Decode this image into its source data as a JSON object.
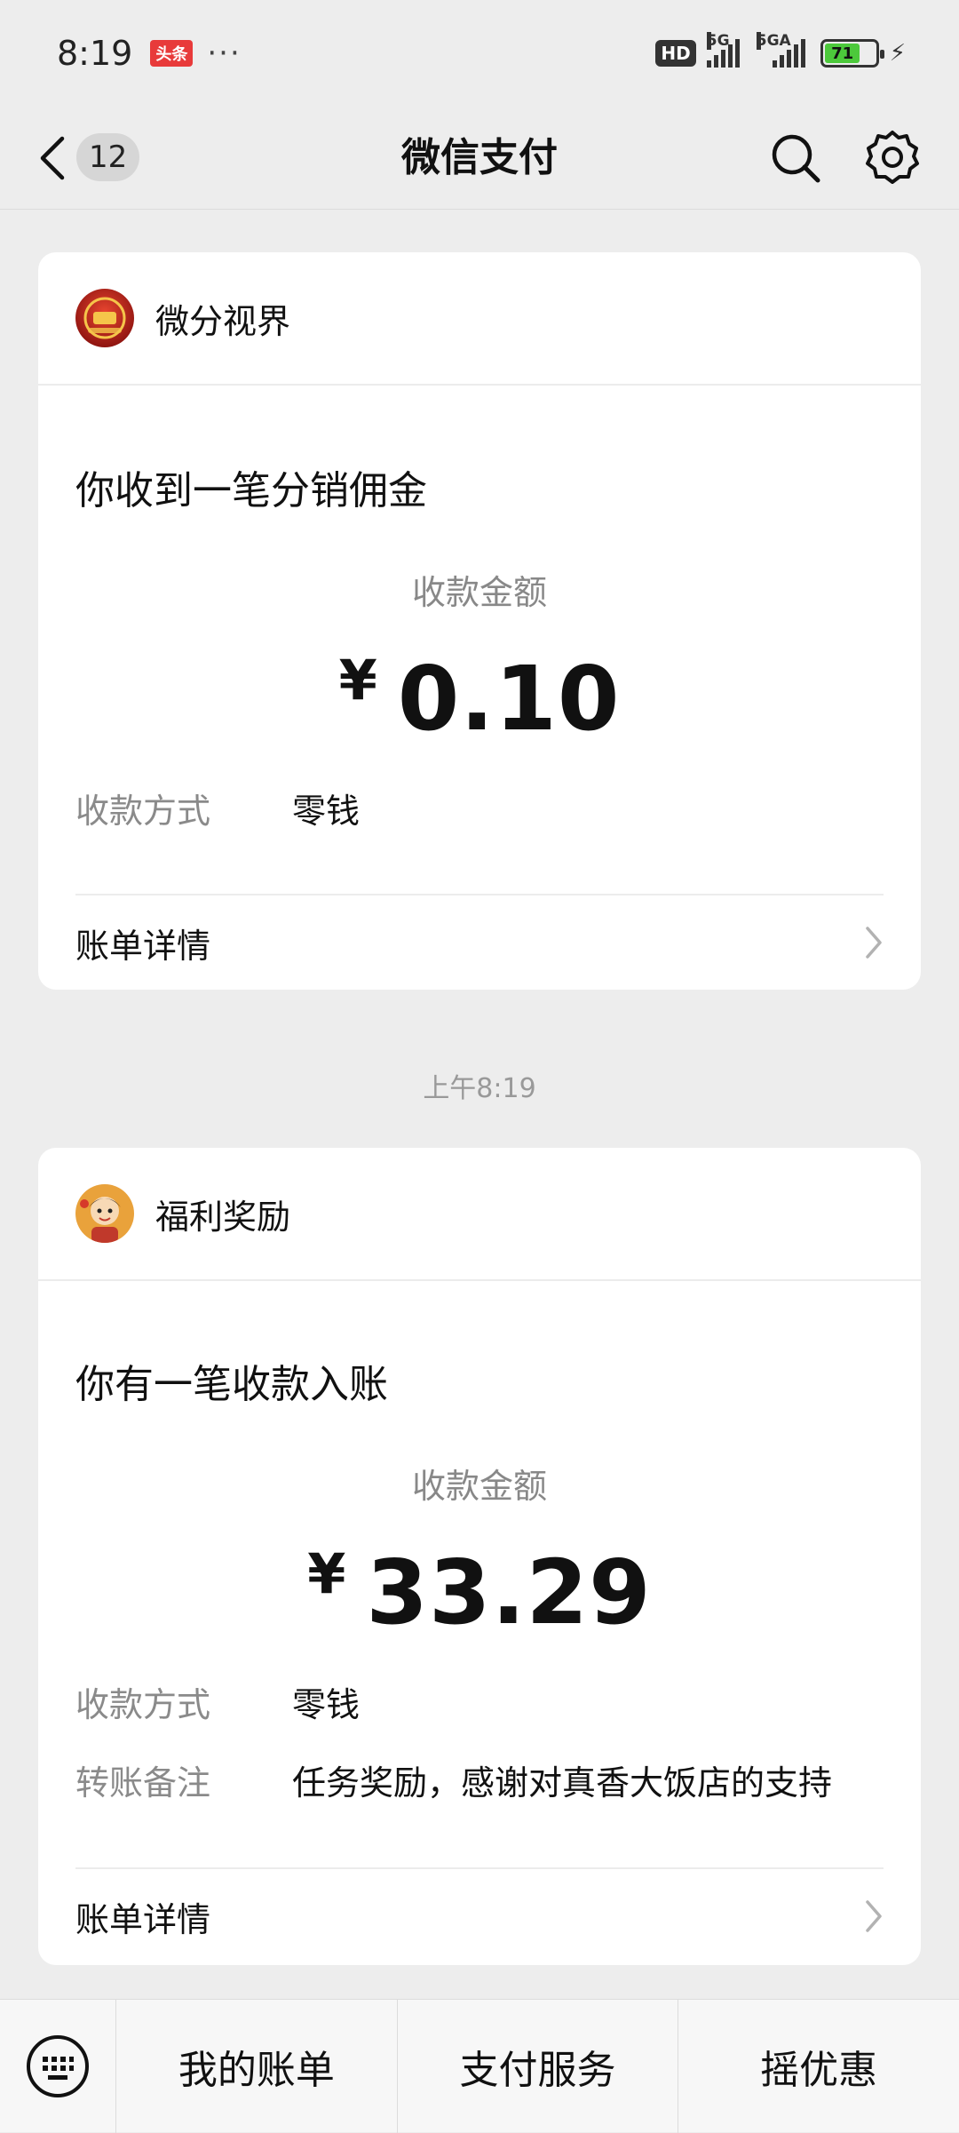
{
  "status_bar": {
    "time": "8:19",
    "app_badge": "头条",
    "dots": "···",
    "hd": "HD",
    "signal1_label": "5G",
    "signal2_label": "5GA",
    "battery": "71"
  },
  "nav": {
    "unread_count": "12",
    "title": "微信支付"
  },
  "messages": [
    {
      "merchant": "微分视界",
      "title": "你收到一笔分销佣金",
      "amount_label": "收款金额",
      "currency": "¥",
      "amount": "0.10",
      "rows": [
        {
          "label": "收款方式",
          "value": "零钱"
        }
      ],
      "bill_label": "账单详情"
    },
    {
      "merchant": "福利奖励",
      "title": "你有一笔收款入账",
      "amount_label": "收款金额",
      "currency": "¥",
      "amount": "33.29",
      "rows": [
        {
          "label": "收款方式",
          "value": "零钱"
        },
        {
          "label": "转账备注",
          "value": "任务奖励，感谢对真香大饭店的支持"
        }
      ],
      "bill_label": "账单详情"
    }
  ],
  "time_separator": "上午8:19",
  "bottom_menu": [
    "我的账单",
    "支付服务",
    "摇优惠"
  ],
  "colors": {
    "background": "#ededed",
    "card": "#ffffff",
    "muted_text": "#888888",
    "battery_green": "#4cc93b"
  },
  "icons": {
    "back": "chevron-left-icon",
    "search": "search-icon",
    "settings": "gear-icon",
    "chevron": "chevron-right-icon",
    "keyboard": "keyboard-icon"
  }
}
